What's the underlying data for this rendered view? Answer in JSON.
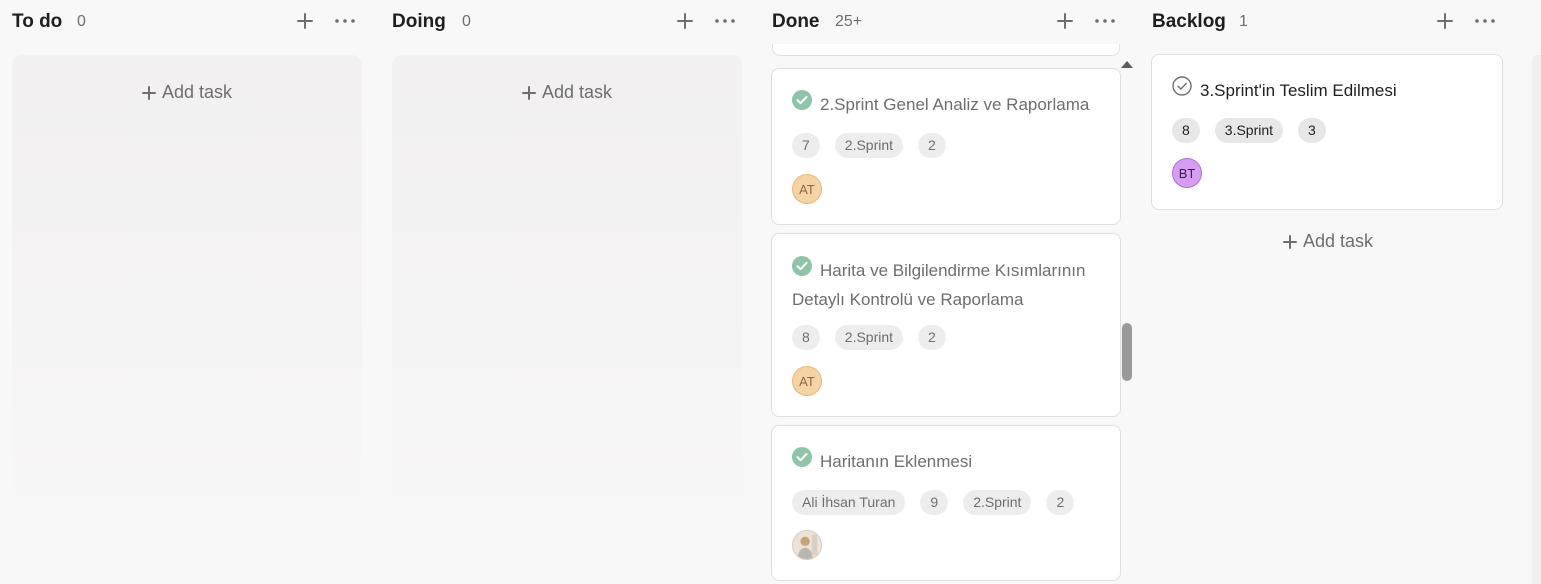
{
  "columns": {
    "todo": {
      "title": "To do",
      "count": "0",
      "add_task": "Add task"
    },
    "doing": {
      "title": "Doing",
      "count": "0",
      "add_task": "Add task"
    },
    "done": {
      "title": "Done",
      "count": "25+",
      "cards": [
        {
          "title": "2.Sprint Genel Analiz ve Raporlama",
          "status": "completed",
          "tags": [
            "7",
            "2.Sprint",
            "2"
          ],
          "assignee": "AT"
        },
        {
          "title_line1": "Harita ve Bilgilendirme Kısımlarının",
          "title_line2": "Detaylı Kontrolü ve Raporlama",
          "status": "completed",
          "tags": [
            "8",
            "2.Sprint",
            "2"
          ],
          "assignee": "AT"
        },
        {
          "title": "Haritanın Eklenmesi",
          "status": "completed",
          "tags": [
            "Ali İhsan Turan",
            "9",
            "2.Sprint",
            "2"
          ],
          "assignee": "photo-avatar"
        }
      ]
    },
    "backlog": {
      "title": "Backlog",
      "count": "1",
      "add_task": "Add task",
      "cards": [
        {
          "title": "3.Sprint'in Teslim Edilmesi",
          "status": "incomplete",
          "tags": [
            "8",
            "3.Sprint",
            "3"
          ],
          "assignee": "BT"
        }
      ]
    }
  },
  "icons": {
    "add": "plus-icon",
    "more": "ellipsis-icon",
    "done_check": "check-circle-filled-icon",
    "open_check": "check-circle-outline-icon"
  },
  "colors": {
    "check_green": "#8fc4a8",
    "avatar_at": "#f5d3a5",
    "avatar_bt": "#d69ef0"
  }
}
